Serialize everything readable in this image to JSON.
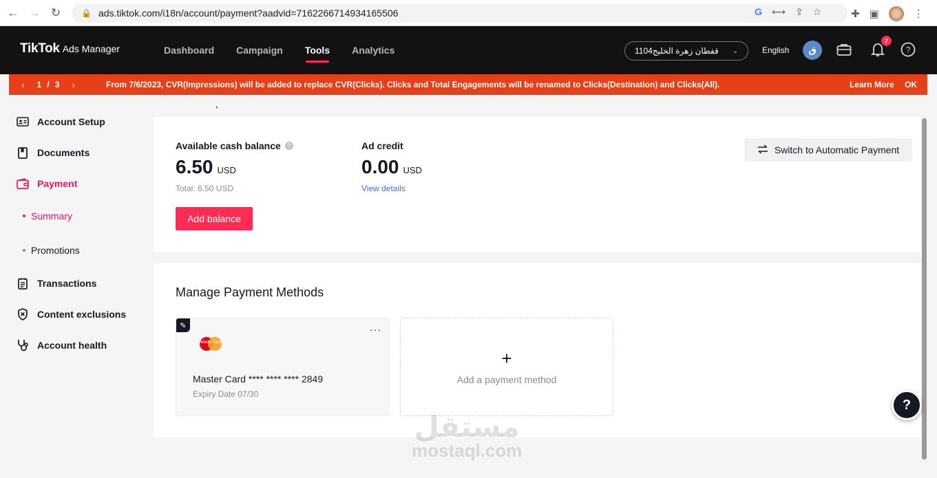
{
  "browser": {
    "url": "ads.tiktok.com/i18n/account/payment?aadvid=7162266714934165506"
  },
  "header": {
    "logo": "TikTok",
    "logo_sub": "Ads Manager",
    "nav": [
      {
        "label": "Dashboard"
      },
      {
        "label": "Campaign"
      },
      {
        "label": "Tools",
        "active": true
      },
      {
        "label": "Analytics"
      }
    ],
    "account_name": "قفطان زهرة الخليج1104",
    "language": "English",
    "avatar_initial": "ق",
    "notification_count": "7"
  },
  "notice": {
    "page": "1",
    "separator": "/",
    "total": "3",
    "message": "From 7/6/2023, CVR(Impressions) will be added to replace CVR(Clicks). Clicks and Total Engagements will be renamed to Clicks(Destination) and Clicks(All).",
    "learn_more": "Learn More",
    "ok": "OK"
  },
  "sidebar": {
    "items": [
      {
        "label": "Account Setup",
        "icon": "id-card-icon"
      },
      {
        "label": "Documents",
        "icon": "document-icon"
      },
      {
        "label": "Payment",
        "icon": "wallet-icon",
        "active": true
      },
      {
        "label": "Transactions",
        "icon": "receipt-icon"
      },
      {
        "label": "Content exclusions",
        "icon": "shield-x-icon"
      },
      {
        "label": "Account health",
        "icon": "stethoscope-icon"
      }
    ],
    "sub_items": [
      {
        "label": "Summary",
        "active": true
      },
      {
        "label": "Promotions"
      }
    ]
  },
  "balance": {
    "cash_label": "Available cash balance",
    "cash_value": "6.50",
    "cash_unit": "USD",
    "cash_total": "Total: 6.50 USD",
    "credit_label": "Ad credit",
    "credit_value": "0.00",
    "credit_unit": "USD",
    "view_details": "View details",
    "add_balance": "Add balance",
    "switch_label": "Switch to Automatic Payment"
  },
  "methods": {
    "title": "Manage Payment Methods",
    "card_number": "Master Card **** **** **** 2849",
    "expiry": "Expiry Date 07/30",
    "card_logo_text": "MasterCard",
    "more": "···",
    "add_method": "Add a payment method",
    "plus": "+"
  },
  "watermark": {
    "arabic": "مستقل",
    "latin": "mostaql.com"
  },
  "help": "?",
  "stray_mark": ","
}
